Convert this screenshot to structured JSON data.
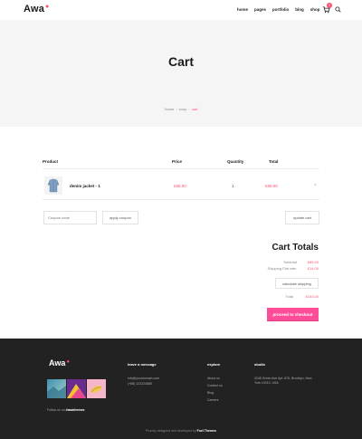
{
  "header": {
    "logo": "Awa",
    "nav": [
      "home",
      "pages",
      "portfolio",
      "blog",
      "shop"
    ],
    "cart_count": "0",
    "icons": {
      "cart": "cart-icon",
      "search": "search-icon"
    }
  },
  "hero": {
    "title": "Cart",
    "breadcrumb": [
      "Home",
      "shop",
      "cart"
    ]
  },
  "cart": {
    "columns": [
      "Product",
      "Price",
      "Quantity",
      "Total"
    ],
    "rows": [
      {
        "name": "denim jacket - 1",
        "price": "£85.00",
        "quantity": "1",
        "total": "£85.00",
        "remove": "×"
      }
    ],
    "coupon_placeholder": "Coupon code",
    "apply_label": "apply coupon",
    "update_label": "update cart"
  },
  "totals": {
    "title": "Cart Totals",
    "subtotal_label": "Subtotal",
    "subtotal_value": "£85.00",
    "shipping_label": "Shipping Flat rate:",
    "shipping_value": "£14.00",
    "calc_label": "calculate shipping",
    "total_label": "Total",
    "total_value": "£103.00",
    "checkout_label": "proceed to checkout"
  },
  "footer": {
    "logo": "Awa",
    "follow_prefix": "Follow us on",
    "follow_handle": "#awathemes",
    "leave_title": "leave a message",
    "email": "info@yourdomain.com",
    "phone": "(+88) 123224888",
    "explore_title": "explore",
    "links": [
      "About us",
      "Contact us",
      "Blog",
      "Careers"
    ],
    "studio_title": "studio",
    "address": "2045 Green Ave Apt. 876, Brooklyn, New York 10010, USA",
    "copyright_prefix": "Proudly designed and developed by",
    "copyright_brand": "Fuel Themes"
  },
  "colors": {
    "accent": "#ff4d6d",
    "checkout": "#ff4d9a",
    "footer_bg": "#222222",
    "hero_bg": "#f5f5f5"
  }
}
